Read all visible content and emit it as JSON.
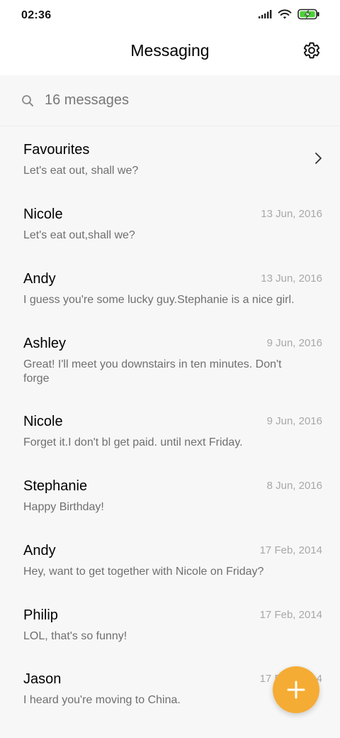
{
  "status_bar": {
    "time": "02:36",
    "icons": [
      "signal-icon",
      "wifi-icon",
      "battery-charging-icon"
    ],
    "battery_color": "#4cd137"
  },
  "header": {
    "title": "Messaging",
    "settings_icon": "gear-icon"
  },
  "search": {
    "icon": "search-icon",
    "text": "16 messages"
  },
  "favourites": {
    "name": "Favourites",
    "preview": "Let's eat out, shall we?",
    "icon": "chevron-right-icon"
  },
  "conversations": [
    {
      "name": "Nicole",
      "date": "13 Jun, 2016",
      "preview": "Let's eat out,shall we?"
    },
    {
      "name": "Andy",
      "date": "13 Jun, 2016",
      "preview": "I guess you're some lucky guy.Stephanie is a nice girl."
    },
    {
      "name": "Ashley",
      "date": "9 Jun, 2016",
      "preview": "Great! I'll meet you downstairs in ten minutes. Don't forge"
    },
    {
      "name": "Nicole",
      "date": "9 Jun, 2016",
      "preview": "Forget it.I don't bl get paid. until next Friday."
    },
    {
      "name": "Stephanie",
      "date": "8 Jun, 2016",
      "preview": "Happy Birthday!"
    },
    {
      "name": "Andy",
      "date": "17 Feb, 2014",
      "preview": "Hey, want to get together with Nicole on Friday?"
    },
    {
      "name": "Philip",
      "date": "17 Feb, 2014",
      "preview": "LOL, that's so funny!"
    },
    {
      "name": "Jason",
      "date": "17 Feb, 2014",
      "preview": "I heard you're moving to China."
    }
  ],
  "fab": {
    "icon": "plus-icon",
    "color": "#f5ac34"
  }
}
